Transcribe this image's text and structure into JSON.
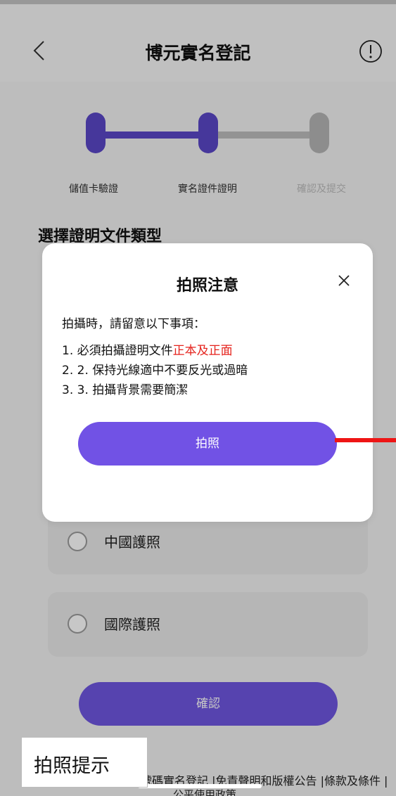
{
  "header": {
    "title": "博元實名登記"
  },
  "stepper": {
    "steps": [
      "儲值卡驗證",
      "實名證件證明",
      "確認及提交"
    ]
  },
  "section": {
    "title": "選擇證明文件類型"
  },
  "options": [
    {
      "label": "中國護照"
    },
    {
      "label": "國際護照"
    }
  ],
  "confirm_label": "確認",
  "footer": {
    "links": "號碼實名登記 |免責聲明和版權公告 |條款及條件 |",
    "partial": "公平使用政策"
  },
  "modal": {
    "title": "拍照注意",
    "intro": "拍攝時，請留意以下事項：",
    "line1_prefix": "1. 必須拍攝證明文件",
    "line1_highlight": "正本及正面",
    "line2": "2. 2. 保持光線適中不要反光或過暗",
    "line3": "3. 3. 拍攝背景需要簡潔",
    "button_label": "拍照"
  },
  "caption": "拍照提示",
  "colors": {
    "accent": "#7152e5",
    "highlight": "#e5231d",
    "annotation": "#ee1515"
  }
}
